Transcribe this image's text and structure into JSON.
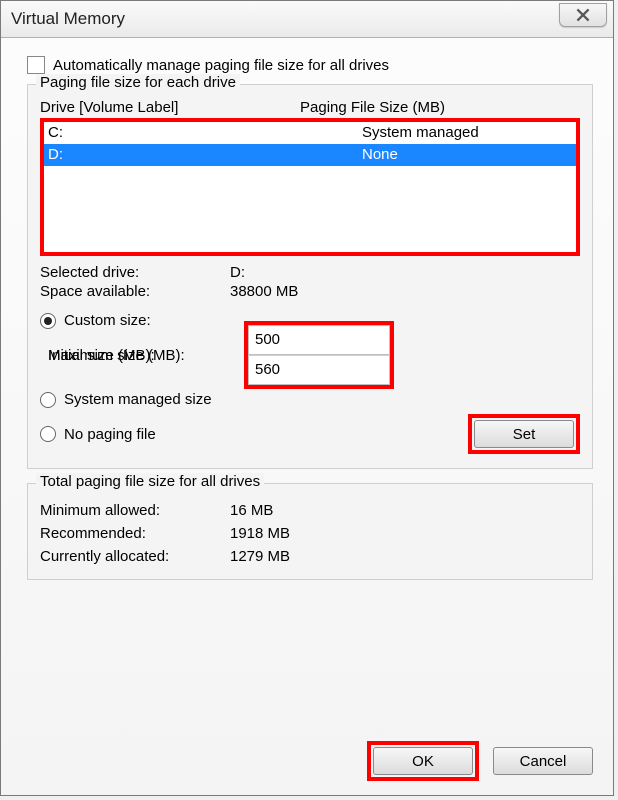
{
  "window": {
    "title": "Virtual Memory"
  },
  "auto_manage": {
    "label": "Automatically manage paging file size for all drives",
    "checked": false
  },
  "drive_group": {
    "legend": "Paging file size for each drive",
    "header_drive": "Drive  [Volume Label]",
    "header_size": "Paging File Size (MB)",
    "rows": [
      {
        "drive": "C:",
        "size": "System managed",
        "selected": false
      },
      {
        "drive": "D:",
        "size": "None",
        "selected": true
      }
    ],
    "selected_drive_label": "Selected drive:",
    "selected_drive_value": "D:",
    "space_label": "Space available:",
    "space_value": "38800 MB",
    "custom_label": "Custom size:",
    "initial_label": "Initial size (MB):",
    "initial_value": "500",
    "max_label": "Maximum size (MB):",
    "max_value": "560",
    "system_managed_label": "System managed size",
    "no_paging_label": "No paging file",
    "set_button": "Set"
  },
  "totals_group": {
    "legend": "Total paging file size for all drives",
    "min_label": "Minimum allowed:",
    "min_value": "16 MB",
    "rec_label": "Recommended:",
    "rec_value": "1918 MB",
    "alloc_label": "Currently allocated:",
    "alloc_value": "1279 MB"
  },
  "buttons": {
    "ok": "OK",
    "cancel": "Cancel"
  }
}
